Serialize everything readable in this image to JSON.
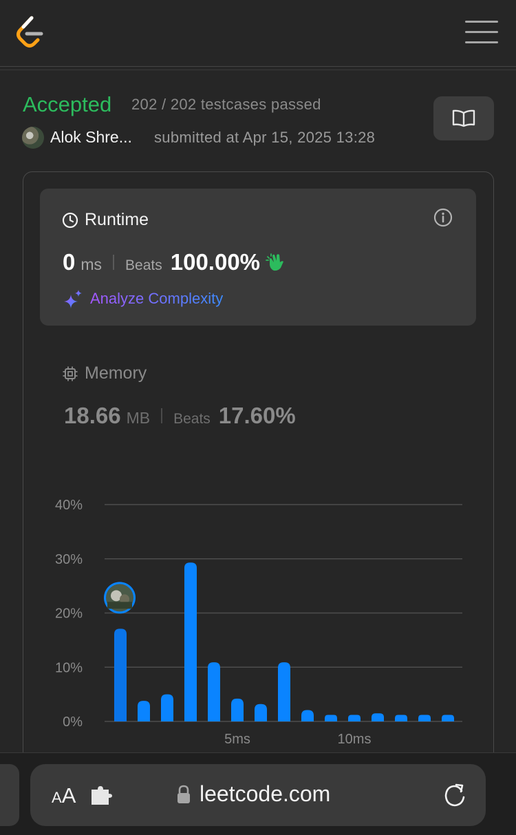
{
  "submission": {
    "status": "Accepted",
    "testcases": "202 / 202 testcases passed",
    "username": "Alok Shre...",
    "submitted_at": "submitted at Apr 15, 2025 13:28"
  },
  "runtime": {
    "title": "Runtime",
    "value": "0",
    "unit": "ms",
    "beats_label": "Beats",
    "beats_value": "100.00%",
    "analyze_label": "Analyze Complexity"
  },
  "memory": {
    "title": "Memory",
    "value": "18.66",
    "unit": "MB",
    "beats_label": "Beats",
    "beats_value": "17.60%"
  },
  "colors": {
    "accepted": "#2cbb5d",
    "bar": "#0a84ff",
    "clap": "#2cbb5d"
  },
  "icons": {
    "logo": "leetcode-logo",
    "menu": "hamburger-menu-icon",
    "book": "book-open-icon",
    "clock": "clock-icon",
    "info": "info-icon",
    "sparkle": "sparkle-icon",
    "chip": "chip-icon",
    "clap": "clapping-hands-icon",
    "extension": "puzzle-icon",
    "lock": "lock-icon",
    "reload": "reload-icon"
  },
  "chart_data": {
    "type": "bar",
    "x": [
      0,
      1,
      2,
      3,
      4,
      5,
      6,
      7,
      8,
      9,
      10,
      11,
      12,
      13,
      14
    ],
    "values": [
      17.1,
      3.8,
      5.0,
      29.3,
      10.9,
      4.2,
      3.2,
      10.9,
      2.1,
      1.2,
      1.2,
      1.5,
      1.2,
      1.2,
      1.2
    ],
    "y_ticks": [
      "0%",
      "10%",
      "20%",
      "30%",
      "40%"
    ],
    "x_ticks": [
      {
        "x": 5,
        "label": "5ms"
      },
      {
        "x": 10,
        "label": "10ms"
      }
    ],
    "ylim": [
      0,
      40
    ],
    "grid": true,
    "highlight_index": 0
  },
  "browser": {
    "aa_small": "A",
    "aa_large": "A",
    "url": "leetcode.com"
  }
}
